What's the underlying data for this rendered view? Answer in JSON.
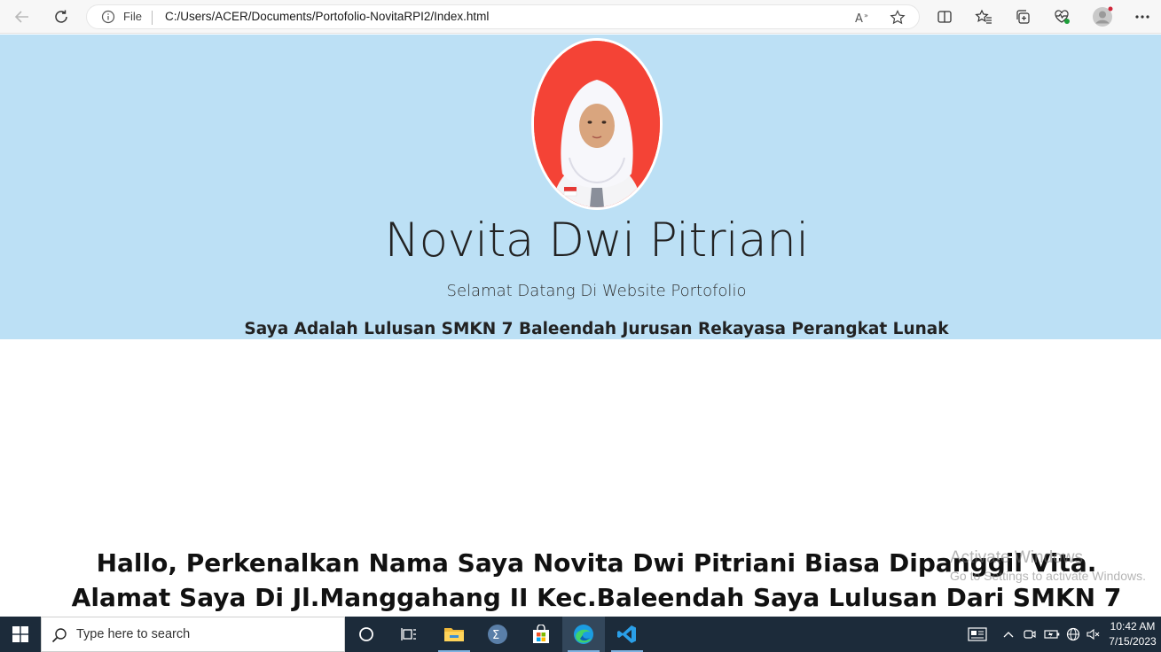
{
  "browser": {
    "address_prefix": "File",
    "url": "C:/Users/ACER/Documents/Portofolio-NovitaRPI2/Index.html",
    "icons": [
      "back-icon",
      "refresh-icon",
      "info-icon",
      "read-aloud-icon",
      "favorite-star-icon",
      "split-screen-icon",
      "favorites-icon",
      "collections-icon",
      "browser-essentials-icon",
      "profile-avatar",
      "more-icon"
    ]
  },
  "hero": {
    "background": "#bce0f5",
    "name": "Novita Dwi Pitriani",
    "welcome": "Selamat Datang Di Website Portofolio",
    "graduate": "Saya Adalah Lulusan SMKN 7 Baleendah Jurusan Rekayasa Perangkat Lunak"
  },
  "intro": {
    "line1": "Hallo, Perkenalkan Nama Saya Novita Dwi Pitriani Biasa Dipanggil Vita.",
    "line2": "Alamat Saya Di Jl.Manggahang II Kec.Baleendah Saya Lulusan Dari SMKN 7"
  },
  "watermark": {
    "line1": "Activate Windows",
    "line2": "Go to Settings to activate Windows."
  },
  "taskbar": {
    "search_placeholder": "Type here to search",
    "apps": [
      "cortana-icon",
      "task-view-icon",
      "file-explorer-icon",
      "wolfram-icon",
      "microsoft-store-icon",
      "edge-icon",
      "vscode-icon"
    ],
    "time": "10:42 AM",
    "date": "7/15/2023"
  }
}
